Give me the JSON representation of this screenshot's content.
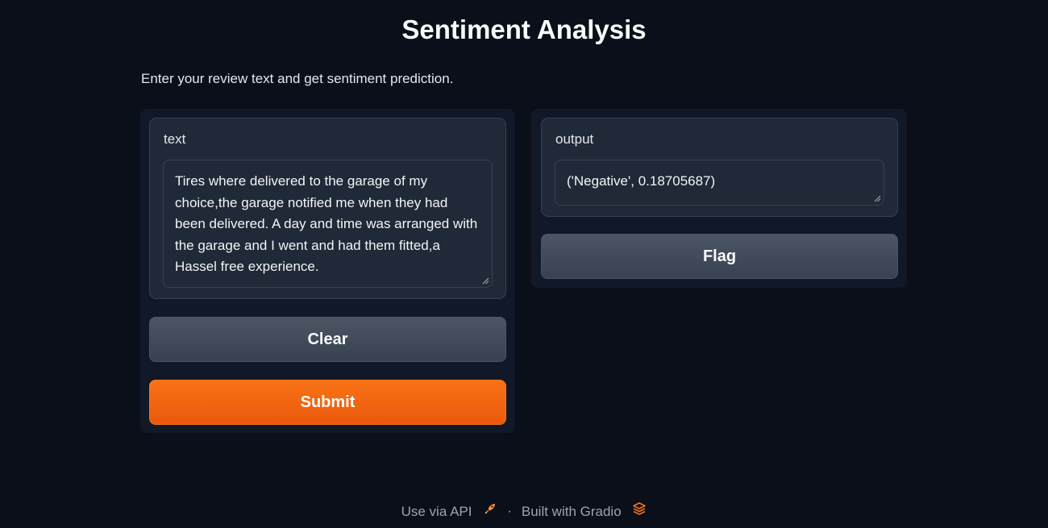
{
  "header": {
    "title": "Sentiment Analysis",
    "description": "Enter your review text and get sentiment prediction."
  },
  "input": {
    "label": "text",
    "value": "Tires where delivered to the garage of my choice,the garage notified me when they had been delivered. A day and time was arranged with the garage and I went and had them fitted,a Hassel free experience."
  },
  "output": {
    "label": "output",
    "value": "('Negative', 0.18705687)"
  },
  "buttons": {
    "clear": "Clear",
    "submit": "Submit",
    "flag": "Flag"
  },
  "footer": {
    "api_link": "Use via API",
    "separator": "·",
    "built_with": "Built with Gradio"
  },
  "colors": {
    "background": "#0b0f19",
    "panel": "#111827",
    "block": "#1f2937",
    "accent": "#f97316",
    "secondary_button": "#4b5563"
  },
  "icons": {
    "api": "rocket-icon",
    "gradio": "gradio-logo-icon"
  }
}
